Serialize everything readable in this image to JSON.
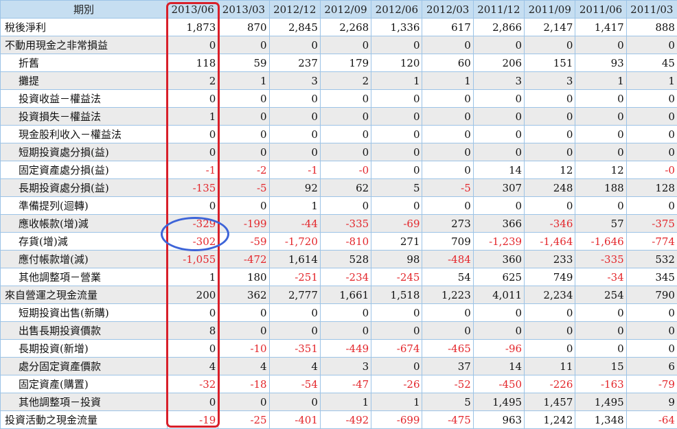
{
  "header": {
    "label": "期別",
    "periods": [
      "2013/06",
      "2013/03",
      "2012/12",
      "2012/09",
      "2012/06",
      "2012/03",
      "2011/12",
      "2011/09",
      "2011/06",
      "2011/03"
    ]
  },
  "rows": [
    {
      "label": "稅後淨利",
      "indent": false,
      "shade": false,
      "values": [
        "1,873",
        "870",
        "2,845",
        "2,268",
        "1,336",
        "617",
        "2,866",
        "2,147",
        "1,417",
        "888"
      ]
    },
    {
      "label": "不動用現金之非常損益",
      "indent": false,
      "shade": true,
      "values": [
        "0",
        "0",
        "0",
        "0",
        "0",
        "0",
        "0",
        "0",
        "0",
        "0"
      ]
    },
    {
      "label": "折舊",
      "indent": true,
      "shade": false,
      "values": [
        "118",
        "59",
        "237",
        "179",
        "120",
        "60",
        "206",
        "151",
        "93",
        "45"
      ]
    },
    {
      "label": "攤提",
      "indent": true,
      "shade": true,
      "values": [
        "2",
        "1",
        "3",
        "2",
        "1",
        "1",
        "3",
        "3",
        "1",
        "1"
      ]
    },
    {
      "label": "投資收益－權益法",
      "indent": true,
      "shade": false,
      "values": [
        "0",
        "0",
        "0",
        "0",
        "0",
        "0",
        "0",
        "0",
        "0",
        "0"
      ]
    },
    {
      "label": "投資損失－權益法",
      "indent": true,
      "shade": true,
      "values": [
        "1",
        "0",
        "0",
        "0",
        "0",
        "0",
        "0",
        "0",
        "0",
        "0"
      ]
    },
    {
      "label": "現金股利收入－權益法",
      "indent": true,
      "shade": false,
      "values": [
        "0",
        "0",
        "0",
        "0",
        "0",
        "0",
        "0",
        "0",
        "0",
        "0"
      ]
    },
    {
      "label": "短期投資處分損(益)",
      "indent": true,
      "shade": true,
      "values": [
        "0",
        "0",
        "0",
        "0",
        "0",
        "0",
        "0",
        "0",
        "0",
        "0"
      ]
    },
    {
      "label": "固定資產處分損(益)",
      "indent": true,
      "shade": false,
      "values": [
        "-1",
        "-2",
        "-1",
        "-0",
        "0",
        "0",
        "14",
        "12",
        "12",
        "-0"
      ]
    },
    {
      "label": "長期投資處分損(益)",
      "indent": true,
      "shade": true,
      "values": [
        "-135",
        "-5",
        "92",
        "62",
        "5",
        "-5",
        "307",
        "248",
        "188",
        "128"
      ]
    },
    {
      "label": "準備提列(迴轉)",
      "indent": true,
      "shade": false,
      "values": [
        "0",
        "0",
        "1",
        "0",
        "0",
        "0",
        "0",
        "0",
        "0",
        "0"
      ]
    },
    {
      "label": "應收帳款(增)減",
      "indent": true,
      "shade": true,
      "values": [
        "-329",
        "-199",
        "-44",
        "-335",
        "-69",
        "273",
        "366",
        "-346",
        "57",
        "-375"
      ]
    },
    {
      "label": "存貨(增)減",
      "indent": true,
      "shade": false,
      "values": [
        "-302",
        "-59",
        "-1,720",
        "-810",
        "271",
        "709",
        "-1,239",
        "-1,464",
        "-1,646",
        "-774"
      ]
    },
    {
      "label": "應付帳款增(減)",
      "indent": true,
      "shade": true,
      "values": [
        "-1,055",
        "-472",
        "1,614",
        "528",
        "98",
        "-484",
        "360",
        "233",
        "-335",
        "532"
      ]
    },
    {
      "label": "其他調整項－營業",
      "indent": true,
      "shade": false,
      "values": [
        "1",
        "180",
        "-251",
        "-234",
        "-245",
        "54",
        "625",
        "749",
        "-34",
        "345"
      ]
    },
    {
      "label": "來自營運之現金流量",
      "indent": false,
      "shade": true,
      "values": [
        "200",
        "362",
        "2,777",
        "1,661",
        "1,518",
        "1,223",
        "4,011",
        "2,234",
        "254",
        "790"
      ]
    },
    {
      "label": "短期投資出售(新購)",
      "indent": true,
      "shade": false,
      "values": [
        "0",
        "0",
        "0",
        "0",
        "0",
        "0",
        "0",
        "0",
        "0",
        "0"
      ]
    },
    {
      "label": "出售長期投資價款",
      "indent": true,
      "shade": true,
      "values": [
        "8",
        "0",
        "0",
        "0",
        "0",
        "0",
        "0",
        "0",
        "0",
        "0"
      ]
    },
    {
      "label": "長期投資(新增)",
      "indent": true,
      "shade": false,
      "values": [
        "0",
        "-10",
        "-351",
        "-449",
        "-674",
        "-465",
        "-96",
        "0",
        "0",
        "0"
      ]
    },
    {
      "label": "處分固定資產價款",
      "indent": true,
      "shade": true,
      "values": [
        "4",
        "4",
        "4",
        "3",
        "0",
        "37",
        "14",
        "11",
        "15",
        "6"
      ]
    },
    {
      "label": "固定資產(購置)",
      "indent": true,
      "shade": false,
      "values": [
        "-32",
        "-18",
        "-54",
        "-47",
        "-26",
        "-52",
        "-450",
        "-226",
        "-163",
        "-79"
      ]
    },
    {
      "label": "其他調整項－投資",
      "indent": true,
      "shade": true,
      "values": [
        "0",
        "0",
        "0",
        "1",
        "1",
        "5",
        "1,495",
        "1,457",
        "1,495",
        "9"
      ]
    },
    {
      "label": "投資活動之現金流量",
      "indent": false,
      "shade": false,
      "values": [
        "-19",
        "-25",
        "-401",
        "-492",
        "-699",
        "-475",
        "963",
        "1,242",
        "1,348",
        "-64"
      ]
    }
  ]
}
